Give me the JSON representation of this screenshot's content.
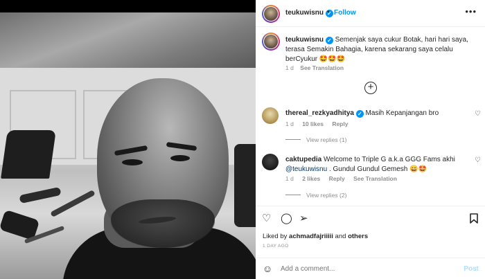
{
  "post": {
    "username": "teukuwisnu",
    "follow_label": "Follow",
    "more_label": "•••",
    "separator": "•"
  },
  "caption": {
    "username": "teukuwisnu",
    "text": "Semenjak saya cukur Botak, hari hari saya, terasa Semakin Bahagia, karena sekarang saya celalu berCyukur 🤩🤩🤩",
    "time": "1 d",
    "translation_label": "See Translation"
  },
  "add_replies_icon": "plus-circle-icon",
  "comments": [
    {
      "username": "thereal_rezkyadhitya",
      "text": "Masih Kepanjangan bro",
      "time": "1 d",
      "likes": "10 likes",
      "reply_label": "Reply",
      "view_replies": "View replies (1)"
    },
    {
      "username": "caktupedia",
      "text_before": "Welcome to Triple G a.k.a GGG Fams akhi ",
      "mention": "@teukuwisnu",
      "text_after": " . Gundul Gundul Gemesh 😄🤩",
      "time": "1 d",
      "likes": "2 likes",
      "reply_label": "Reply",
      "translation_label": "See Translation",
      "view_replies": "View replies (2)"
    }
  ],
  "likes_line": {
    "prefix": "Liked by ",
    "user": "achmadfajriiiii",
    "middle": " and ",
    "others": "others"
  },
  "time_ago": "1 DAY AGO",
  "composer": {
    "placeholder": "Add a comment...",
    "post_label": "Post"
  },
  "icons": {
    "like": "heart-icon",
    "comment": "comment-icon",
    "share": "paper-plane-icon",
    "save": "bookmark-icon",
    "emoji": "smiley-icon",
    "verified": "verified-badge-icon"
  }
}
